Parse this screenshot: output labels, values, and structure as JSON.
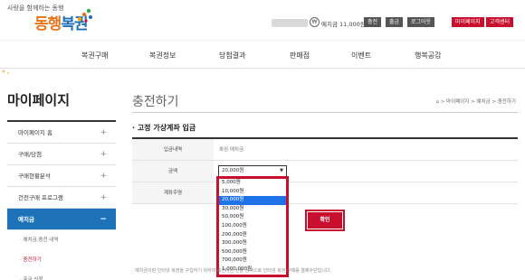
{
  "header": {
    "tagline": "사랑을 함께하는 동행",
    "logo_text_1": "동행",
    "logo_text_2": "복권",
    "coin_icon": "coin-icon",
    "balance": "예치금 11,000원",
    "buttons": [
      "충전",
      "출금",
      "로그아웃"
    ],
    "red_buttons": [
      "마이페이지",
      "고객센터"
    ]
  },
  "gnb": [
    "복권구매",
    "복권정보",
    "당첨결과",
    "판매점",
    "이벤트",
    "행복공감"
  ],
  "sidebar": {
    "title": "마이페이지",
    "items": [
      {
        "label": "마이페이지 홈",
        "sign": "+"
      },
      {
        "label": "구매/당첨",
        "sign": "+"
      },
      {
        "label": "구매현황분석",
        "sign": "+"
      },
      {
        "label": "건전구매 프로그램",
        "sign": "+"
      },
      {
        "label": "예치금",
        "sign": "−"
      }
    ],
    "sub_items": [
      "· 예치금 충전 내역",
      "· 충전하기",
      "· 출금 신청"
    ]
  },
  "main": {
    "title": "충전하기",
    "breadcrumb": "> 마이페이지 > 예치금 > 충전하기",
    "home_icon": "home-icon",
    "section_title": "· 고정 가상계좌 입금",
    "rows": [
      {
        "label": "입금내역",
        "value": "복권 예치금"
      },
      {
        "label": "금액",
        "value": ""
      },
      {
        "label": "계좌주명",
        "value": ""
      }
    ],
    "select_value": "20,000원",
    "options": [
      "5,000원",
      "10,000원",
      "20,000원",
      "30,000원",
      "50,000원",
      "100,000원",
      "200,000원",
      "300,000원",
      "500,000원",
      "700,000원",
      "1,000,000원"
    ],
    "selected_option": "20,000원",
    "confirm_label": "확인",
    "notice": "· 예치금이란 인터넷 복권을 구입하기 위하여 충전하는 선불 금액으로 인터넷 복권 구매를 결제수단입니다."
  }
}
